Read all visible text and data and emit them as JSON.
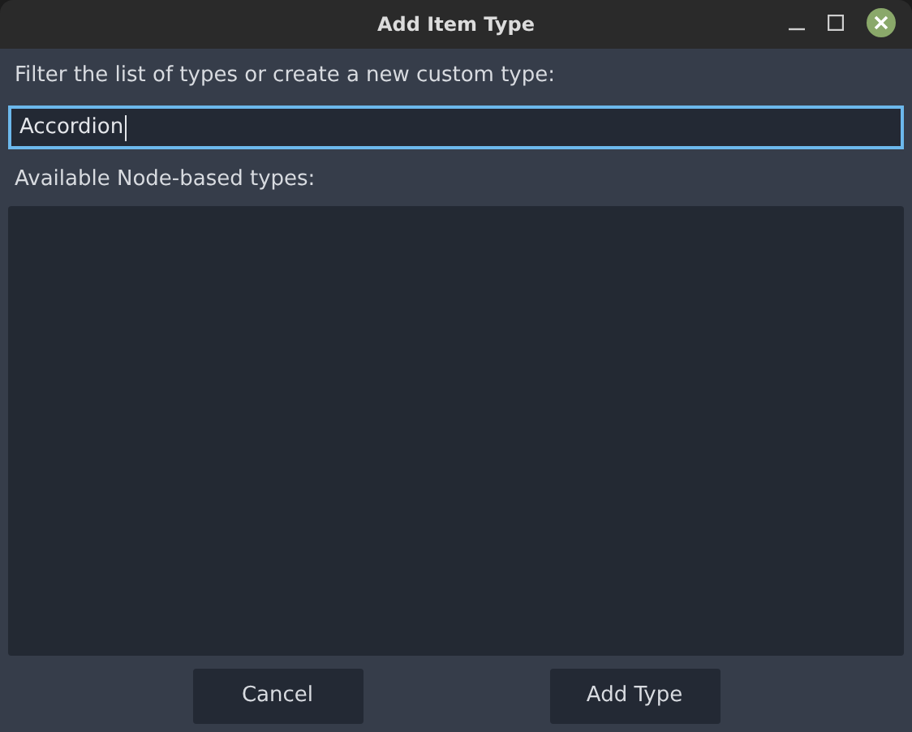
{
  "window": {
    "title": "Add Item Type"
  },
  "filter_label": "Filter the list of types or create a new custom type:",
  "filter_field": {
    "value": "Accordion",
    "focused": true
  },
  "list_label": "Available Node-based types:",
  "buttons": [
    {
      "label": "Cancel"
    },
    {
      "label": "Add Type"
    }
  ]
}
